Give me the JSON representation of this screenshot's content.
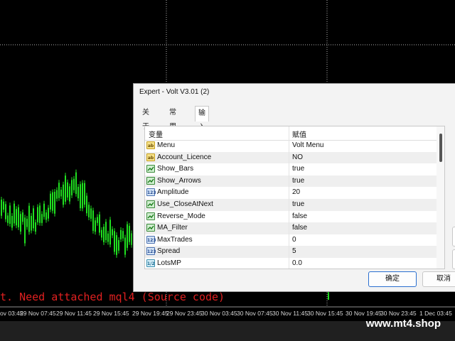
{
  "chart": {
    "error_text": "t. Need attached mql4 (Source code)",
    "time_labels": [
      "ov 03:45",
      "29 Nov 07:45",
      "29 Nov 11:45",
      "29 Nov 15:45",
      "29 Nov 19:45",
      "29 Nov 23:45",
      "30 Nov 03:45",
      "30 Nov 07:45",
      "30 Nov 11:45",
      "30 Nov 15:45",
      "30 Nov 19:45",
      "30 Nov 23:45",
      "1 Dec 03:45"
    ],
    "watermark": "www.mt4.shop",
    "candle_color": "#20e020"
  },
  "dialog": {
    "title": "Expert - Volt V3.01 (2)",
    "tabs": [
      {
        "label": "关于"
      },
      {
        "label": "常用"
      },
      {
        "label": "输入参数"
      }
    ],
    "active_tab": "输入参数",
    "columns": {
      "variable": "变量",
      "value": "赋值"
    },
    "params": [
      {
        "icon": "ab",
        "name": "Menu",
        "value": "Volt Menu"
      },
      {
        "icon": "ab",
        "name": "Account_Licence",
        "value": "NO"
      },
      {
        "icon": "bool",
        "name": "Show_Bars",
        "value": "true"
      },
      {
        "icon": "bool",
        "name": "Show_Arrows",
        "value": "true"
      },
      {
        "icon": "num",
        "name": "Amplitude",
        "value": "20"
      },
      {
        "icon": "bool",
        "name": "Use_CloseAtNext",
        "value": "true"
      },
      {
        "icon": "bool",
        "name": "Reverse_Mode",
        "value": "false"
      },
      {
        "icon": "bool",
        "name": "MA_Filter",
        "value": "false"
      },
      {
        "icon": "num",
        "name": "MaxTrades",
        "value": "0"
      },
      {
        "icon": "num",
        "name": "Spread",
        "value": "5"
      },
      {
        "icon": "dbl",
        "name": "LotsMP",
        "value": "0.0"
      }
    ],
    "ok_label": "确定",
    "cancel_label": "取消"
  }
}
